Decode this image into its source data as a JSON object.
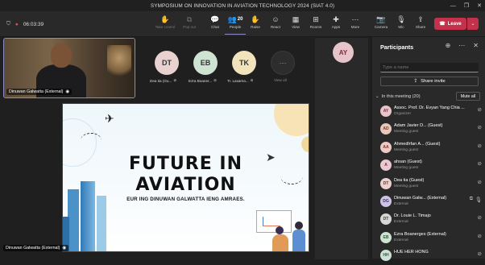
{
  "window": {
    "title": "SYMPOSIUM ON INNOVATION IN AVIATION TECHNOLOGY 2024 (SIAT 4.0)"
  },
  "toolbar": {
    "timer": "06:03:39",
    "buttons": [
      {
        "label": "Take control",
        "icon": "hand-control-icon"
      },
      {
        "label": "Pop out",
        "icon": "pop-out-icon"
      },
      {
        "label": "Chat",
        "icon": "chat-icon"
      },
      {
        "label": "People",
        "icon": "people-icon",
        "count": "20"
      },
      {
        "label": "Raise",
        "icon": "raise-hand-icon"
      },
      {
        "label": "React",
        "icon": "react-icon"
      },
      {
        "label": "View",
        "icon": "view-icon"
      },
      {
        "label": "Rooms",
        "icon": "rooms-icon"
      },
      {
        "label": "Apps",
        "icon": "apps-icon"
      },
      {
        "label": "More",
        "icon": "more-icon"
      },
      {
        "label": "Camera",
        "icon": "camera-off-icon"
      },
      {
        "label": "Mic",
        "icon": "mic-off-icon"
      },
      {
        "label": "Share",
        "icon": "share-icon"
      }
    ],
    "leave_label": "Leave"
  },
  "stage": {
    "video_name": "Dinuwan Galwatta (External)",
    "participants": [
      {
        "initials": "DT",
        "name": "Dea tia (Gu...",
        "color": "#e9d1cf"
      },
      {
        "initials": "EB",
        "name": "Ezra Boaner...",
        "color": "#cfe3d2"
      },
      {
        "initials": "TK",
        "name": "Tr. Laxama...",
        "color": "#f1e4bc"
      }
    ],
    "view_all_label": "View all",
    "ay_initials": "AY",
    "share_name": "Dinuwan Galwatta (External)"
  },
  "slide": {
    "title_line1": "FUTURE IN",
    "title_line2": "AVIATION",
    "subtitle": "EUR ING DINUWAN GALWATTA IENG AMRAES."
  },
  "panel": {
    "title": "Participants",
    "search_placeholder": "Type a name",
    "share_invite_label": "Share invite",
    "in_meeting_label": "In this meeting (20)",
    "mute_all_label": "Mute all",
    "people": [
      {
        "initials": "AY",
        "name": "Assoc. Prof. Dr. Evyan Yang Chia ...",
        "role": "Organizer",
        "color": "#e6c4c9",
        "fg": "#7a2c3b"
      },
      {
        "initials": "AD",
        "name": "Adam Javier D...  (Guest)",
        "role": "Meeting guest",
        "color": "#e8c7bd",
        "fg": "#7a3a2c"
      },
      {
        "initials": "AA",
        "name": "Ahmedlrfan A...  (Guest)",
        "role": "Meeting guest",
        "color": "#efc9c3",
        "fg": "#7c3326"
      },
      {
        "initials": "A",
        "name": "ahsan (Guest)",
        "role": "Meeting guest",
        "color": "#eac8cf",
        "fg": "#7a2c3b"
      },
      {
        "initials": "DT",
        "name": "Dea tia (Guest)",
        "role": "Meeting guest",
        "color": "#e9d1cf",
        "fg": "#6a3a33"
      },
      {
        "initials": "DG",
        "name": "Dinuwan Galw...  (External)",
        "role": "External",
        "color": "#cfc2e6",
        "fg": "#3b2d6a"
      },
      {
        "initials": "DT",
        "name": "Dr. Louie L. Timajo",
        "role": "External",
        "color": "#d6d6d6",
        "fg": "#444444"
      },
      {
        "initials": "EB",
        "name": "Ezra Boanerges (External)",
        "role": "External",
        "color": "#cfe3d2",
        "fg": "#2f5b39"
      },
      {
        "initials": "HH",
        "name": "HUE HER HONG",
        "role": "",
        "color": "#cfe0d6",
        "fg": "#2f5b43"
      }
    ]
  }
}
